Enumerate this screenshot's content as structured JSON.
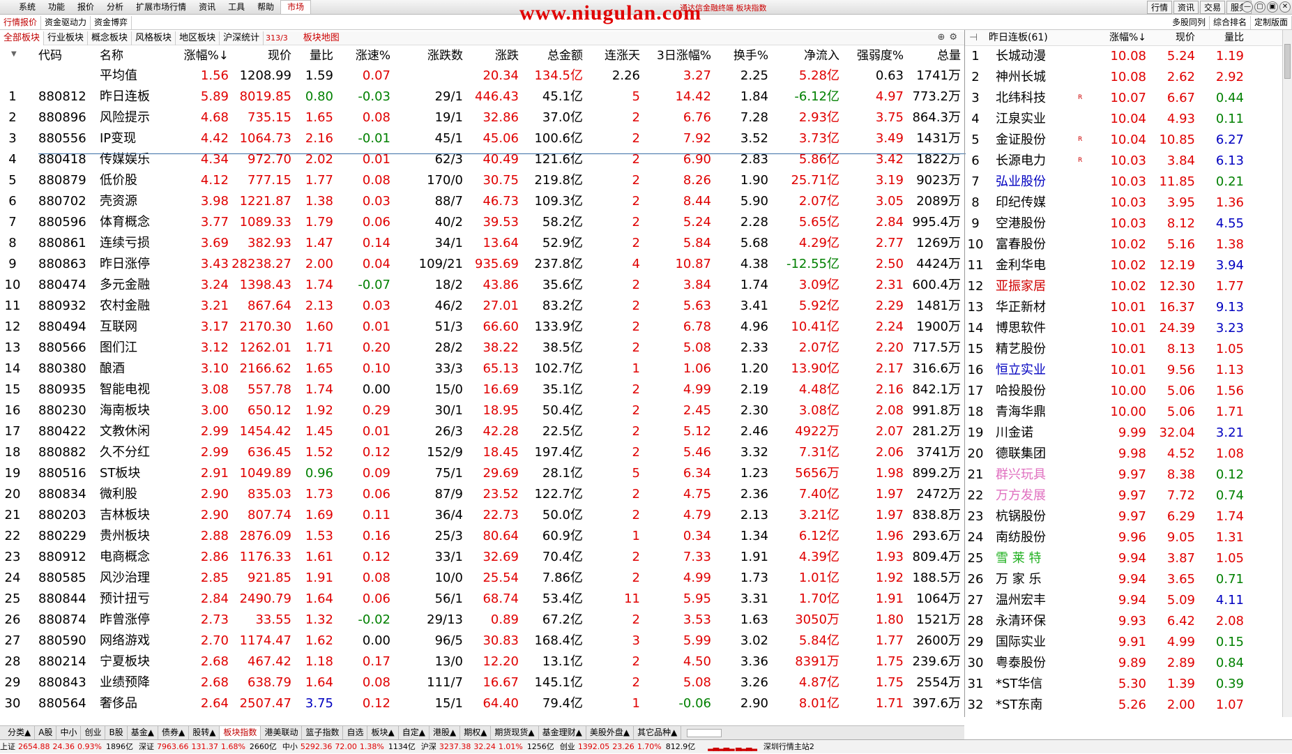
{
  "menu": [
    "系统",
    "功能",
    "报价",
    "分析",
    "扩展市场行情",
    "资讯",
    "工具",
    "帮助",
    "市场"
  ],
  "watermark": "www.niugulan.com",
  "title_sub": "通达信金融终端 板块指数",
  "top_right": [
    "行情",
    "资讯",
    "交易",
    "服务"
  ],
  "window_buttons": [
    "—",
    "▢",
    "▣",
    "✕"
  ],
  "tabs": [
    "行情报价",
    "资金驱动力",
    "资金博弈"
  ],
  "tabs_right": [
    "多股同列",
    "综合排名",
    "定制版面"
  ],
  "categories": [
    "全部板块",
    "行业板块",
    "概念板块",
    "风格板块",
    "地区板块",
    "沪深统计"
  ],
  "cat_count": "313/3",
  "cat_map": "板块地图",
  "cat_icons": [
    "zoom-icon",
    "gear-icon"
  ],
  "headers": [
    "代码",
    "名称",
    "涨幅%↓",
    "现价",
    "量比",
    "涨速%",
    "涨跌数",
    "涨跌",
    "总金额",
    "连涨天",
    "3日涨幅%",
    "换手%",
    "净流入",
    "强弱度%",
    "总量"
  ],
  "avg_row": {
    "name": "平均值",
    "cells": [
      "1.56",
      "1208.99",
      "1.59",
      "0.07",
      "",
      "20.34",
      "134.5亿",
      "2.26",
      "3.27",
      "2.25",
      "5.28亿",
      "0.63",
      "1741万"
    ]
  },
  "rows": [
    [
      "1",
      "880812",
      "昨日连板",
      "5.89",
      "8019.85",
      "0.80",
      "-0.03",
      "29/1",
      "446.43",
      "45.1亿",
      "5",
      "14.42",
      "1.84",
      "-6.12亿",
      "4.97",
      "773.2万"
    ],
    [
      "2",
      "880896",
      "风险提示",
      "4.68",
      "735.15",
      "1.65",
      "0.08",
      "19/1",
      "32.86",
      "37.0亿",
      "2",
      "6.76",
      "7.28",
      "2.93亿",
      "3.75",
      "864.3万"
    ],
    [
      "3",
      "880556",
      "IP变现",
      "4.42",
      "1064.73",
      "2.16",
      "-0.01",
      "45/1",
      "45.06",
      "100.6亿",
      "2",
      "7.92",
      "3.52",
      "3.73亿",
      "3.49",
      "1431万"
    ],
    [
      "4",
      "880418",
      "传媒娱乐",
      "4.34",
      "972.70",
      "2.02",
      "0.01",
      "62/3",
      "40.49",
      "121.6亿",
      "2",
      "6.90",
      "2.83",
      "5.86亿",
      "3.42",
      "1822万"
    ],
    [
      "5",
      "880879",
      "低价股",
      "4.12",
      "777.15",
      "1.77",
      "0.08",
      "170/0",
      "30.75",
      "219.8亿",
      "2",
      "8.26",
      "1.90",
      "25.71亿",
      "3.19",
      "9023万"
    ],
    [
      "6",
      "880702",
      "壳资源",
      "3.98",
      "1221.87",
      "1.38",
      "0.03",
      "88/7",
      "46.73",
      "109.3亿",
      "2",
      "8.44",
      "5.90",
      "2.07亿",
      "3.05",
      "2089万"
    ],
    [
      "7",
      "880596",
      "体育概念",
      "3.77",
      "1089.33",
      "1.79",
      "0.06",
      "40/2",
      "39.53",
      "58.2亿",
      "2",
      "5.24",
      "2.28",
      "5.65亿",
      "2.84",
      "995.4万"
    ],
    [
      "8",
      "880861",
      "连续亏损",
      "3.69",
      "382.93",
      "1.47",
      "0.14",
      "34/1",
      "13.64",
      "52.9亿",
      "2",
      "5.84",
      "5.68",
      "4.29亿",
      "2.77",
      "1269万"
    ],
    [
      "9",
      "880863",
      "昨日涨停",
      "3.43",
      "28238.27",
      "2.00",
      "0.04",
      "109/21",
      "935.69",
      "237.8亿",
      "4",
      "10.87",
      "4.38",
      "-12.55亿",
      "2.50",
      "4424万"
    ],
    [
      "10",
      "880474",
      "多元金融",
      "3.24",
      "1398.43",
      "1.74",
      "-0.07",
      "18/2",
      "43.86",
      "35.6亿",
      "2",
      "3.84",
      "1.74",
      "3.09亿",
      "2.31",
      "600.4万"
    ],
    [
      "11",
      "880932",
      "农村金融",
      "3.21",
      "867.64",
      "2.13",
      "0.03",
      "46/2",
      "27.01",
      "83.2亿",
      "2",
      "5.63",
      "3.41",
      "5.92亿",
      "2.29",
      "1481万"
    ],
    [
      "12",
      "880494",
      "互联网",
      "3.17",
      "2170.30",
      "1.60",
      "0.01",
      "51/3",
      "66.60",
      "133.9亿",
      "2",
      "6.78",
      "4.96",
      "10.41亿",
      "2.24",
      "1900万"
    ],
    [
      "13",
      "880566",
      "图们江",
      "3.12",
      "1262.01",
      "1.71",
      "0.20",
      "28/2",
      "38.22",
      "38.5亿",
      "2",
      "5.08",
      "2.33",
      "2.07亿",
      "2.20",
      "717.5万"
    ],
    [
      "14",
      "880380",
      "酿酒",
      "3.10",
      "2166.62",
      "1.65",
      "0.10",
      "33/3",
      "65.13",
      "102.7亿",
      "1",
      "1.06",
      "1.20",
      "13.90亿",
      "2.17",
      "316.6万"
    ],
    [
      "15",
      "880935",
      "智能电视",
      "3.08",
      "557.78",
      "1.74",
      "0.00",
      "15/0",
      "16.69",
      "35.1亿",
      "2",
      "4.99",
      "2.19",
      "4.48亿",
      "2.16",
      "842.1万"
    ],
    [
      "16",
      "880230",
      "海南板块",
      "3.00",
      "650.12",
      "1.92",
      "0.29",
      "30/1",
      "18.95",
      "50.4亿",
      "2",
      "2.45",
      "2.30",
      "3.08亿",
      "2.08",
      "991.8万"
    ],
    [
      "17",
      "880422",
      "文教休闲",
      "2.99",
      "1454.42",
      "1.45",
      "0.01",
      "26/3",
      "42.28",
      "22.5亿",
      "2",
      "5.12",
      "2.46",
      "4922万",
      "2.07",
      "281.2万"
    ],
    [
      "18",
      "880882",
      "久不分红",
      "2.99",
      "636.45",
      "1.52",
      "0.12",
      "152/9",
      "18.45",
      "197.4亿",
      "2",
      "5.46",
      "3.32",
      "7.31亿",
      "2.06",
      "3741万"
    ],
    [
      "19",
      "880516",
      "ST板块",
      "2.91",
      "1049.89",
      "0.96",
      "0.09",
      "75/1",
      "29.69",
      "28.1亿",
      "5",
      "6.34",
      "1.23",
      "5656万",
      "1.98",
      "899.2万"
    ],
    [
      "20",
      "880834",
      "微利股",
      "2.90",
      "835.03",
      "1.73",
      "0.06",
      "87/9",
      "23.52",
      "122.7亿",
      "2",
      "4.75",
      "2.36",
      "7.40亿",
      "1.97",
      "2472万"
    ],
    [
      "21",
      "880203",
      "吉林板块",
      "2.90",
      "807.74",
      "1.69",
      "0.11",
      "36/4",
      "22.73",
      "50.0亿",
      "2",
      "4.79",
      "2.13",
      "3.21亿",
      "1.97",
      "838.8万"
    ],
    [
      "22",
      "880229",
      "贵州板块",
      "2.88",
      "2876.09",
      "1.53",
      "0.16",
      "25/3",
      "80.64",
      "60.9亿",
      "1",
      "0.34",
      "1.34",
      "6.12亿",
      "1.96",
      "293.6万"
    ],
    [
      "23",
      "880912",
      "电商概念",
      "2.86",
      "1176.33",
      "1.61",
      "0.12",
      "33/1",
      "32.69",
      "70.4亿",
      "2",
      "7.33",
      "1.91",
      "4.39亿",
      "1.93",
      "809.4万"
    ],
    [
      "24",
      "880585",
      "风沙治理",
      "2.85",
      "921.85",
      "1.91",
      "0.08",
      "10/0",
      "25.54",
      "7.86亿",
      "2",
      "4.99",
      "1.73",
      "1.01亿",
      "1.92",
      "188.5万"
    ],
    [
      "25",
      "880844",
      "预计扭亏",
      "2.84",
      "2490.79",
      "1.64",
      "0.06",
      "56/1",
      "68.74",
      "53.4亿",
      "11",
      "5.95",
      "3.31",
      "1.70亿",
      "1.91",
      "1064万"
    ],
    [
      "26",
      "880874",
      "昨曾涨停",
      "2.73",
      "33.55",
      "1.32",
      "-0.02",
      "29/13",
      "0.89",
      "67.2亿",
      "2",
      "3.53",
      "1.63",
      "3050万",
      "1.80",
      "1521万"
    ],
    [
      "27",
      "880590",
      "网络游戏",
      "2.70",
      "1174.47",
      "1.62",
      "0.00",
      "96/5",
      "30.83",
      "168.4亿",
      "3",
      "5.99",
      "3.02",
      "5.84亿",
      "1.77",
      "2600万"
    ],
    [
      "28",
      "880214",
      "宁夏板块",
      "2.68",
      "467.42",
      "1.18",
      "0.17",
      "13/0",
      "12.20",
      "13.1亿",
      "2",
      "4.50",
      "3.36",
      "8391万",
      "1.75",
      "239.6万"
    ],
    [
      "29",
      "880843",
      "业绩预降",
      "2.68",
      "638.79",
      "1.64",
      "0.08",
      "111/7",
      "16.67",
      "145.1亿",
      "2",
      "5.08",
      "3.26",
      "4.87亿",
      "1.75",
      "2554万"
    ],
    [
      "30",
      "880564",
      "奢侈品",
      "2.64",
      "2507.47",
      "3.75",
      "0.12",
      "15/1",
      "64.40",
      "79.4亿",
      "1",
      "-0.06",
      "2.90",
      "8.01亿",
      "1.71",
      "397.6万"
    ]
  ],
  "side": {
    "title": "昨日连板(61)",
    "headers": [
      "涨幅%↓",
      "现价",
      "量比"
    ],
    "rows": [
      [
        "1",
        "长城动漫",
        "10.08",
        "5.24",
        "1.19"
      ],
      [
        "2",
        "神州长城",
        "10.08",
        "2.62",
        "2.92"
      ],
      [
        "3",
        "北纬科技",
        "10.07",
        "6.67",
        "0.44"
      ],
      [
        "4",
        "江泉实业",
        "10.04",
        "4.93",
        "0.11"
      ],
      [
        "5",
        "金证股份",
        "10.04",
        "10.85",
        "6.27"
      ],
      [
        "6",
        "长源电力",
        "10.03",
        "3.84",
        "6.13"
      ],
      [
        "7",
        "弘业股份",
        "10.03",
        "11.85",
        "0.21"
      ],
      [
        "8",
        "印纪传媒",
        "10.03",
        "3.95",
        "1.36"
      ],
      [
        "9",
        "空港股份",
        "10.03",
        "8.12",
        "4.55"
      ],
      [
        "10",
        "富春股份",
        "10.02",
        "5.16",
        "1.38"
      ],
      [
        "11",
        "金利华电",
        "10.02",
        "12.19",
        "3.94"
      ],
      [
        "12",
        "亚振家居",
        "10.02",
        "12.30",
        "1.77"
      ],
      [
        "13",
        "华正新材",
        "10.01",
        "16.37",
        "9.13"
      ],
      [
        "14",
        "博思软件",
        "10.01",
        "24.39",
        "3.23"
      ],
      [
        "15",
        "精艺股份",
        "10.01",
        "8.13",
        "1.05"
      ],
      [
        "16",
        "恒立实业",
        "10.01",
        "9.56",
        "1.13"
      ],
      [
        "17",
        "哈投股份",
        "10.00",
        "5.06",
        "1.56"
      ],
      [
        "18",
        "青海华鼎",
        "10.00",
        "5.06",
        "1.71"
      ],
      [
        "19",
        "川金诺",
        "9.99",
        "32.04",
        "3.21"
      ],
      [
        "20",
        "德联集团",
        "9.98",
        "4.52",
        "1.08"
      ],
      [
        "21",
        "群兴玩具",
        "9.97",
        "8.38",
        "0.12"
      ],
      [
        "22",
        "万方发展",
        "9.97",
        "7.72",
        "0.74"
      ],
      [
        "23",
        "杭锅股份",
        "9.97",
        "6.29",
        "1.74"
      ],
      [
        "24",
        "南纺股份",
        "9.96",
        "9.05",
        "1.31"
      ],
      [
        "25",
        "雪 莱 特",
        "9.94",
        "3.87",
        "1.05"
      ],
      [
        "26",
        "万 家 乐",
        "9.94",
        "3.65",
        "0.71"
      ],
      [
        "27",
        "温州宏丰",
        "9.94",
        "5.09",
        "4.11"
      ],
      [
        "28",
        "永清环保",
        "9.93",
        "6.42",
        "2.08"
      ],
      [
        "29",
        "国际实业",
        "9.91",
        "4.99",
        "0.15"
      ],
      [
        "30",
        "粤泰股份",
        "9.89",
        "2.89",
        "0.84"
      ],
      [
        "31",
        "*ST华信",
        "5.30",
        "1.39",
        "0.39"
      ],
      [
        "32",
        "*ST东南",
        "5.26",
        "2.00",
        "1.07"
      ]
    ],
    "r_marks": {
      "3": "R",
      "5": "R",
      "6": "R"
    }
  },
  "bottom_tabs": [
    "分类▲",
    "A股",
    "中小",
    "创业",
    "B股",
    "基金▲",
    "债券▲",
    "股转▲",
    "板块指数",
    "港美联动",
    "篮子指数",
    "自选",
    "板块▲",
    "自定▲",
    "港股▲",
    "期权▲",
    "期货现货▲",
    "基金理财▲",
    "美股外盘▲",
    "其它品种▲"
  ],
  "status": [
    {
      "label": "上证",
      "vals": [
        "2654.88",
        "24.36",
        "0.93%"
      ],
      "amt": "1896亿"
    },
    {
      "label": "深证",
      "vals": [
        "7963.66",
        "131.37",
        "1.68%"
      ],
      "amt": "2660亿"
    },
    {
      "label": "中小",
      "vals": [
        "5292.36",
        "72.00",
        "1.38%"
      ],
      "amt": "1134亿"
    },
    {
      "label": "沪深",
      "vals": [
        "3237.38",
        "32.24",
        "1.01%"
      ],
      "amt": "1256亿"
    },
    {
      "label": "创业",
      "vals": [
        "1392.05",
        "23.26",
        "1.70%"
      ],
      "amt": "812.9亿"
    }
  ],
  "status_station": "深圳行情主站2",
  "colors": {
    "up": "#e00000",
    "down": "#008000",
    "blue": "#0000c0",
    "pink": "#e070c0",
    "green_name": "#20b020",
    "red_name": "#d00000"
  }
}
